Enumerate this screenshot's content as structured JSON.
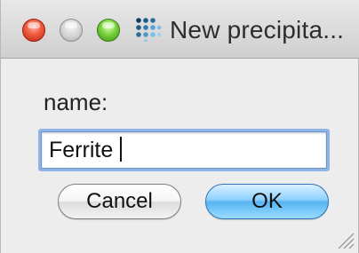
{
  "window": {
    "title": "New precipita...",
    "controls": [
      {
        "name": "close",
        "color": "#ef5a3b"
      },
      {
        "name": "minimize",
        "color": "#c8c8c8"
      },
      {
        "name": "maximize",
        "color": "#73cf37"
      }
    ],
    "app_icon": "dot-grid-icon"
  },
  "form": {
    "name_label": "name:",
    "name_value": "Ferrite"
  },
  "buttons": {
    "cancel": "Cancel",
    "ok": "OK"
  },
  "colors": {
    "focus_ring": "#8fb4e8",
    "default_button": "#57b4f2"
  }
}
